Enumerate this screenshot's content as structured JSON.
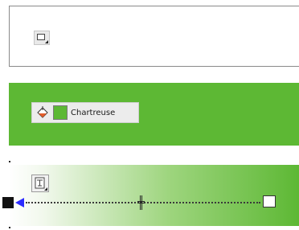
{
  "fill_none": {
    "icon": "fill-square-icon",
    "state": "none"
  },
  "fill_solid": {
    "icon": "paint-bucket-icon",
    "swatch_color": "#5db834",
    "color_name": "Chartreuse",
    "panel_color": "#5db834"
  },
  "fill_gradient": {
    "icon": "gradient-icon",
    "gradient_start_color": "#ffffff",
    "gradient_end_color": "#5db834",
    "left_stop_color": "#111111",
    "right_stop_color": "#ffffff",
    "arrow_color": "#2b2bff"
  }
}
